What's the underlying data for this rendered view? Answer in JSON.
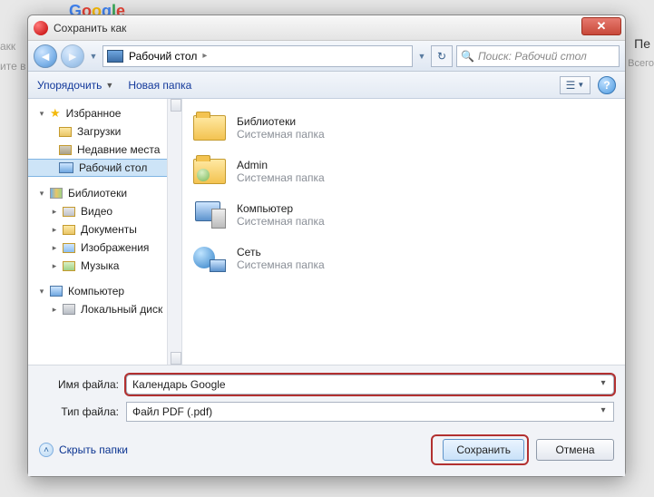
{
  "bg": {
    "google": "Google",
    "left1": "акк",
    "left2": "ите в",
    "right1": "Пе",
    "right2": "Всего"
  },
  "dialog": {
    "title": "Сохранить как",
    "breadcrumb": {
      "location": "Рабочий стол"
    },
    "search_placeholder": "Поиск: Рабочий стол",
    "toolbar": {
      "organize": "Упорядочить",
      "new_folder": "Новая папка"
    },
    "sidebar": {
      "favorites": "Избранное",
      "downloads": "Загрузки",
      "recent": "Недавние места",
      "desktop": "Рабочий стол",
      "libraries": "Библиотеки",
      "video": "Видео",
      "documents": "Документы",
      "pictures": "Изображения",
      "music": "Музыка",
      "computer": "Компьютер",
      "local_disk": "Локальный диск"
    },
    "content": {
      "system_folder": "Системная папка",
      "libraries": "Библиотеки",
      "admin": "Admin",
      "computer": "Компьютер",
      "network": "Сеть"
    },
    "filename_label": "Имя файла:",
    "filetype_label": "Тип файла:",
    "filename_value": "Календарь Google",
    "filetype_value": "Файл PDF (.pdf)",
    "hide_folders": "Скрыть папки",
    "save": "Сохранить",
    "cancel": "Отмена"
  }
}
